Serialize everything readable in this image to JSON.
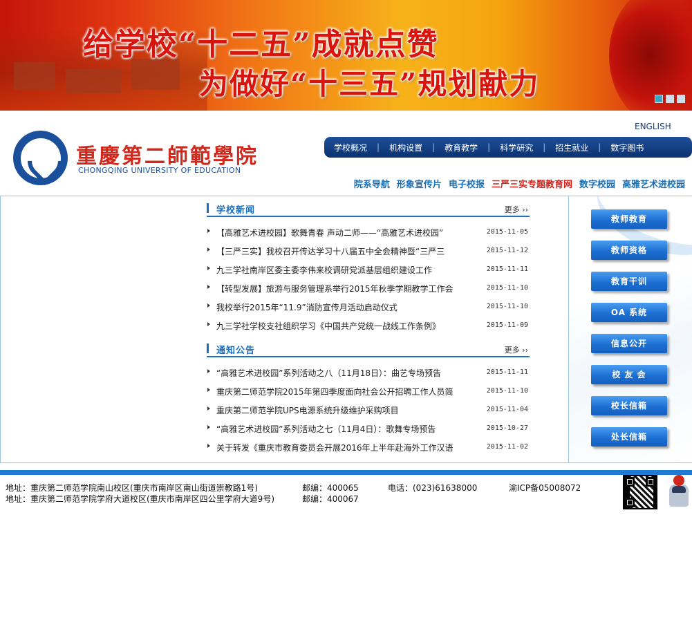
{
  "banner": {
    "headline1": "给学校“十二五”成就点赞",
    "headline2": "为做好“十三五”规划献力"
  },
  "header": {
    "school_name_cn": "重慶第二師範學院",
    "school_name_en": "CHONGQING UNIVERSITY OF EDUCATION",
    "english_link": "ENGLISH"
  },
  "nav": {
    "items": [
      "学校概况",
      "机构设置",
      "教育教学",
      "科学研究",
      "招生就业",
      "数字图书"
    ],
    "separator": "|"
  },
  "sublinks": [
    "院系导航",
    "形象宣传片",
    "电子校报",
    "三严三实专题教育网",
    "数字校园",
    "高雅艺术进校园"
  ],
  "news": {
    "title": "学校新闻",
    "more": "更多 ››",
    "items": [
      {
        "text": "【高雅艺术进校园】歌舞青春 声动二师——“高雅艺术进校园”",
        "date": "2015-11-05"
      },
      {
        "text": "【三严三实】我校召开传达学习十八届五中全会精神暨“三严三",
        "date": "2015-11-12"
      },
      {
        "text": "九三学社南岸区委主委李伟来校调研党派基层组织建设工作",
        "date": "2015-11-11"
      },
      {
        "text": "【转型发展】旅游与服务管理系举行2015年秋季学期教学工作会",
        "date": "2015-11-10"
      },
      {
        "text": "我校举行2015年“11.9”消防宣传月活动启动仪式",
        "date": "2015-11-10"
      },
      {
        "text": "九三学社学校支社组织学习《中国共产党统一战线工作条例》",
        "date": "2015-11-09"
      }
    ]
  },
  "notices": {
    "title": "通知公告",
    "more": "更多 ››",
    "items": [
      {
        "text": "“高雅艺术进校园”系列活动之八（11月18日）：曲艺专场预告",
        "date": "2015-11-11"
      },
      {
        "text": "重庆第二师范学院2015年第四季度面向社会公开招聘工作人员简",
        "date": "2015-11-10"
      },
      {
        "text": "重庆第二师范学院UPS电源系统升级维护采购项目",
        "date": "2015-11-04"
      },
      {
        "text": "“高雅艺术进校园”系列活动之七（11月4日）：歌舞专场预告",
        "date": "2015-10-27"
      },
      {
        "text": "关于转发《重庆市教育委员会开展2016年上半年赴海外工作汉语",
        "date": "2015-11-02"
      }
    ]
  },
  "quick_links": [
    "教师教育",
    "教师资格",
    "教育干训",
    "OA 系统",
    "信息公开",
    "校 友 会",
    "校长信箱",
    "处长信箱"
  ],
  "footer": {
    "address1": "地址：重庆第二师范学院南山校区(重庆市南岸区南山街道崇教路1号)",
    "postcode1": "邮编：400065",
    "phone": "电话：(023)61638000",
    "icp": "渝ICP备05008072",
    "address2": "地址：重庆第二师范学院学府大道校区(重庆市南岸区四公里学府大道9号)",
    "postcode2": "邮编：400067"
  },
  "colors": {
    "brand_blue": "#1a6fc0",
    "nav_dark": "#0b326f",
    "accent_red": "#d4241a"
  }
}
